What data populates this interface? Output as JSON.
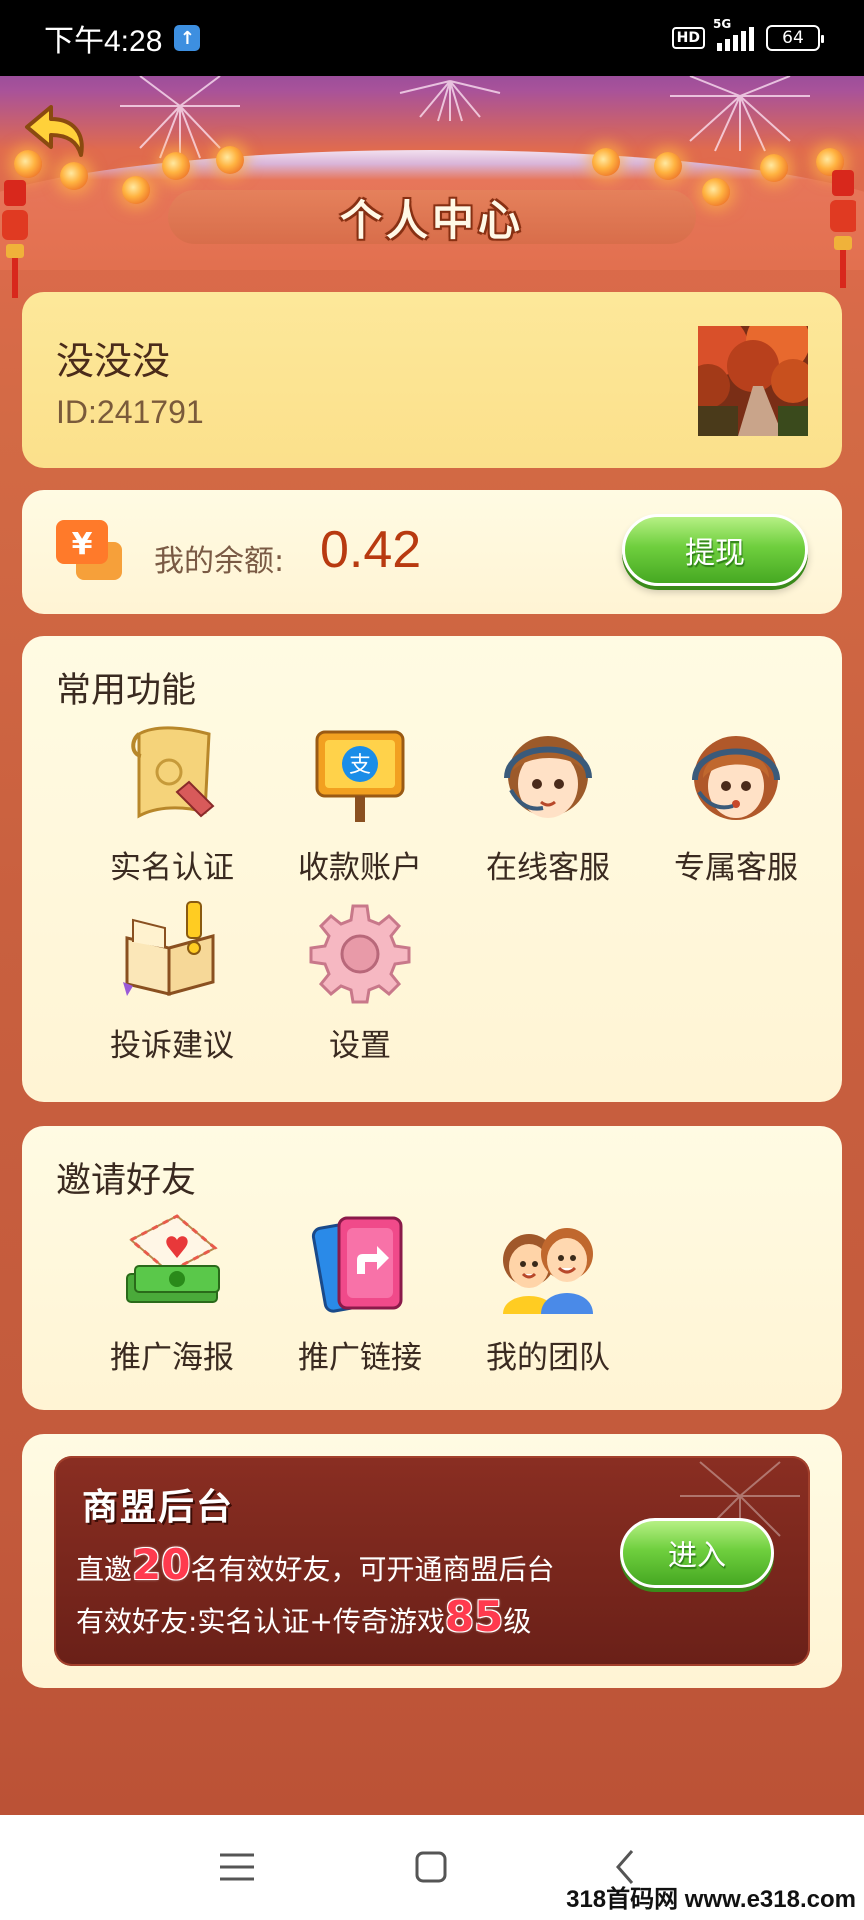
{
  "status_bar": {
    "time": "下午4:28",
    "network": "5G",
    "hd": "HD",
    "battery": "64"
  },
  "header": {
    "title": "个人中心"
  },
  "profile": {
    "username": "没没没",
    "user_id": "ID:241791"
  },
  "balance": {
    "label": "我的余额:",
    "value": "0.42",
    "withdraw_label": "提现",
    "coin_symbol": "¥"
  },
  "functions": {
    "title": "常用功能",
    "items": [
      {
        "label": "实名认证",
        "icon": "scroll-icon"
      },
      {
        "label": "收款账户",
        "icon": "alipay-sign-icon"
      },
      {
        "label": "在线客服",
        "icon": "male-agent-icon"
      },
      {
        "label": "专属客服",
        "icon": "female-agent-icon"
      },
      {
        "label": "投诉建议",
        "icon": "book-alert-icon"
      },
      {
        "label": "设置",
        "icon": "gear-icon"
      }
    ]
  },
  "invite": {
    "title": "邀请好友",
    "items": [
      {
        "label": "推广海报",
        "icon": "envelope-money-icon"
      },
      {
        "label": "推广链接",
        "icon": "share-card-icon"
      },
      {
        "label": "我的团队",
        "icon": "team-icon"
      }
    ]
  },
  "merchant": {
    "title": "商盟后台",
    "line1_a": "直邀",
    "line1_num": "20",
    "line1_b": "名有效好友，可开通商盟后台",
    "line2_a": "有效好友:实名认证+传奇游戏",
    "line2_num": "85",
    "line2_b": "级",
    "enter_label": "进入"
  },
  "watermark": "318首码网 www.e318.com",
  "colors": {
    "accent_green": "#6fcf3e",
    "balance_red": "#b83a10",
    "card_yellow": "#fde89a",
    "background": "#c9603f"
  }
}
